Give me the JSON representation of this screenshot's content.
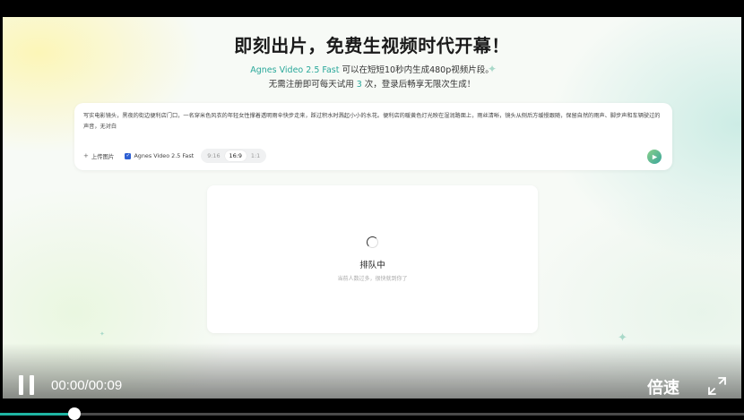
{
  "page": {
    "headline": "即刻出片，免费生视频时代开幕！",
    "subline1": {
      "model_name": "Agnes Video 2.5 Fast",
      "rest": " 可以在短短10秒内生成480p视频片段。"
    },
    "subline2": {
      "before": "无需注册即可每天试用 ",
      "count": "3",
      "after": " 次，登录后畅享无限次生成！"
    }
  },
  "prompt": {
    "text": "写实电影镜头，黑夜的街边便利店门口，一名穿米色风衣的年轻女性撑着透明雨伞快步走来，踩过积水时溅起小小的水花。便利店的暖黄色灯光映在湿润路面上，雨丝清晰，镜头从侧后方缓慢跟随，保留自然的雨声、脚步声和车辆驶过的声音，无对白",
    "upload_label": "上传图片",
    "model_label": "Agnes Video 2.5 Fast",
    "model_checked": true,
    "ratios": [
      {
        "label": "9:16",
        "active": false
      },
      {
        "label": "16:9",
        "active": true
      },
      {
        "label": "1:1",
        "active": false
      }
    ]
  },
  "status": {
    "title": "排队中",
    "subtitle": "当前人数过多，很快就到你了"
  },
  "player": {
    "timecode": "00:00/00:09",
    "speed_label": "倍速",
    "progress": 0.1
  },
  "colors": {
    "accent": "#2aa89a",
    "progress": "#1fb5a3",
    "checkbox": "#2d5fd3"
  },
  "icons": {
    "pause": "pause-icon",
    "fullscreen": "fullscreen-icon",
    "submit": "generate-icon",
    "spinner": "loading-spinner-icon"
  }
}
